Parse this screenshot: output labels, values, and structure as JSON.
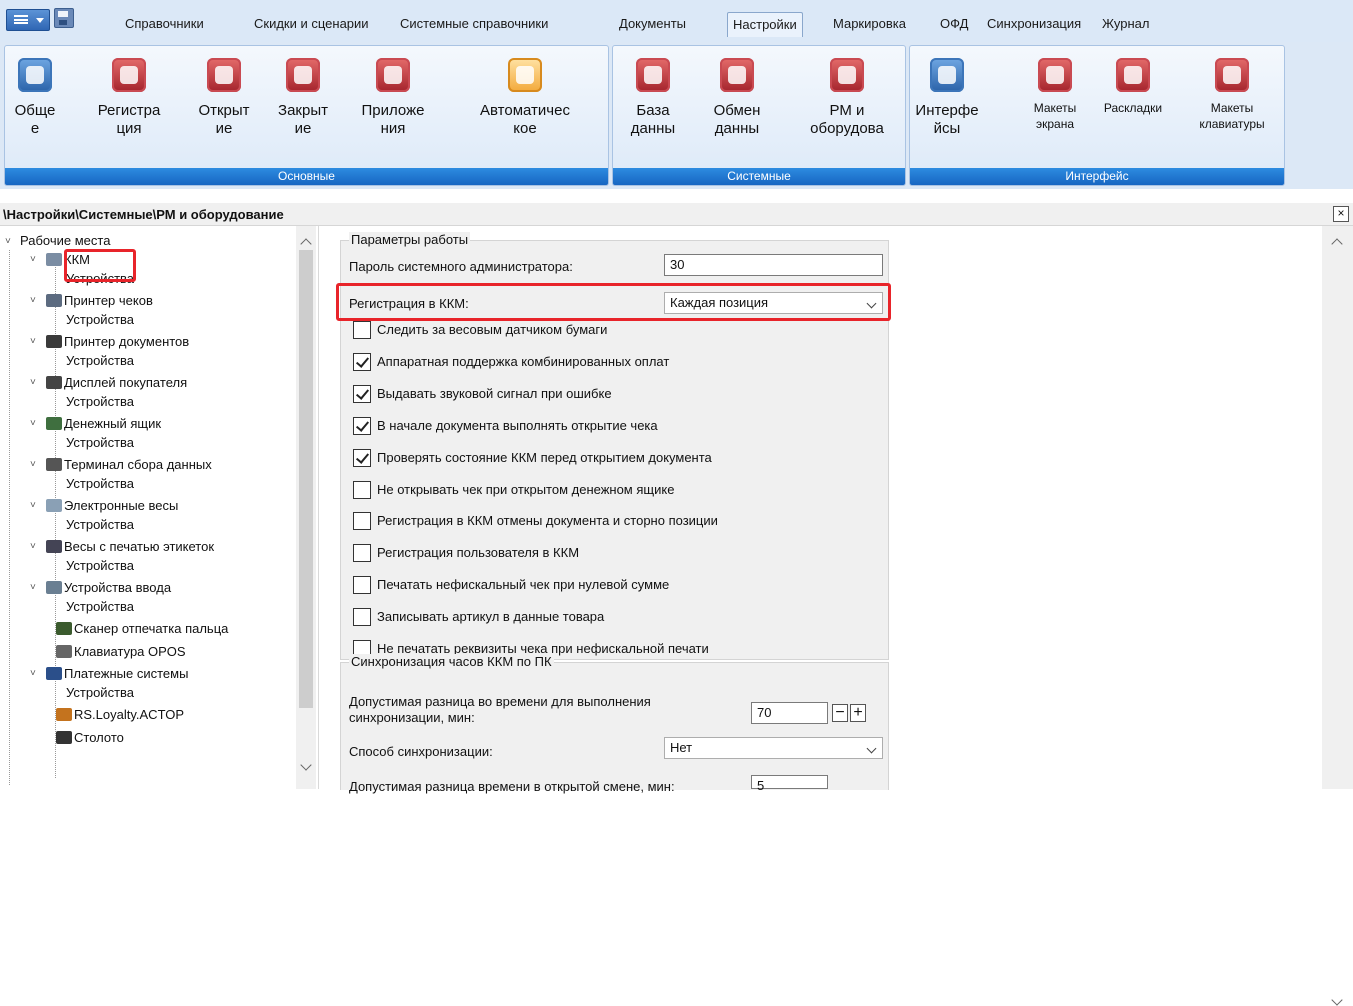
{
  "menu": {
    "tabs": [
      "Справочники",
      "Скидки и сценарии",
      "Системные справочники",
      "Документы",
      "Настройки",
      "Маркировка",
      "ОФД",
      "Синхронизация",
      "Журнал"
    ],
    "active_tab": "Настройки"
  },
  "ribbon": {
    "groups": [
      {
        "label": "Основные",
        "buttons": [
          {
            "label": "Обще\nе",
            "icon": "general-settings-icon"
          },
          {
            "label": "Регистра\nция",
            "icon": "registration-icon"
          },
          {
            "label": "Открыт\nие",
            "icon": "opening-icon"
          },
          {
            "label": "Закрыт\nие",
            "icon": "closing-icon"
          },
          {
            "label": "Приложе\nния",
            "icon": "apps-icon"
          },
          {
            "label": "Автоматичес\nкое",
            "icon": "automatic-icon"
          }
        ]
      },
      {
        "label": "Системные",
        "buttons": [
          {
            "label": "База\nданны",
            "icon": "database-icon"
          },
          {
            "label": "Обмен\nданны",
            "icon": "exchange-icon"
          },
          {
            "label": "РМ и\nоборудова",
            "icon": "workplace-equipment-icon"
          }
        ]
      },
      {
        "label": "Интерфейс",
        "buttons": [
          {
            "label": "Интерфе\nйсы",
            "icon": "interfaces-icon"
          },
          {
            "label": "Макеты\nэкрана",
            "icon": "screen-layouts-icon"
          },
          {
            "label": "Раскладки",
            "icon": "layouts-icon"
          },
          {
            "label": "Макеты\nклавиатуры",
            "icon": "keyboard-layouts-icon"
          }
        ]
      }
    ]
  },
  "breadcrumb": "\\Настройки\\Системные\\РМ и оборудование",
  "close_glyph": "×",
  "tree": {
    "root": "Рабочие места",
    "items": [
      {
        "label": "ККМ",
        "child": "Устройства"
      },
      {
        "label": "Принтер чеков",
        "child": "Устройства"
      },
      {
        "label": "Принтер документов",
        "child": "Устройства"
      },
      {
        "label": "Дисплей покупателя",
        "child": "Устройства"
      },
      {
        "label": "Денежный ящик",
        "child": "Устройства"
      },
      {
        "label": "Терминал сбора данных",
        "child": "Устройства"
      },
      {
        "label": "Электронные весы",
        "child": "Устройства"
      },
      {
        "label": "Весы с печатью этикеток",
        "child": "Устройства"
      },
      {
        "label": "Устройства ввода",
        "child": "Устройства"
      },
      {
        "label": "Сканер отпечатка пальца",
        "child": null
      },
      {
        "label": "Клавиатура OPOS",
        "child": null
      },
      {
        "label": "Платежные системы",
        "child": "Устройства"
      },
      {
        "label": "RS.Loyalty.ACTOP",
        "child": null
      },
      {
        "label": "Столото",
        "child": null
      }
    ]
  },
  "params": {
    "legend": "Параметры работы",
    "admin_password_label": "Пароль системного администратора:",
    "admin_password_value": "30",
    "kkm_registration_label": "Регистрация в ККМ:",
    "kkm_registration_value": "Каждая позиция",
    "checkboxes": [
      {
        "label": "Следить за весовым датчиком бумаги",
        "checked": false
      },
      {
        "label": "Аппаратная поддержка комбинированных оплат",
        "checked": true
      },
      {
        "label": "Выдавать звуковой сигнал при ошибке",
        "checked": true
      },
      {
        "label": "В начале документа выполнять открытие чека",
        "checked": true
      },
      {
        "label": "Проверять состояние ККМ перед открытием документа",
        "checked": true
      },
      {
        "label": "Не открывать чек при открытом денежном ящике",
        "checked": false
      },
      {
        "label": "Регистрация в ККМ отмены документа и сторно позиции",
        "checked": false
      },
      {
        "label": "Регистрация пользователя в ККМ",
        "checked": false
      },
      {
        "label": "Печатать нефискальный чек при нулевой сумме",
        "checked": false
      },
      {
        "label": "Записывать артикул в данные товара",
        "checked": false
      },
      {
        "label": "Не печатать реквизиты чека при нефискальной печати",
        "checked": false
      }
    ]
  },
  "sync": {
    "legend": "Синхронизация часов ККМ по ПК",
    "diff_label_line1": "Допустимая разница во времени для выполнения",
    "diff_label_line2": "синхронизации, мин:",
    "diff_value": "70",
    "method_label": "Способ синхронизации:",
    "method_value": "Нет",
    "partial_label": "Допустимая разница времени в открытой смене, мин:",
    "partial_value": "5"
  },
  "highlight_color": "#e8242a"
}
